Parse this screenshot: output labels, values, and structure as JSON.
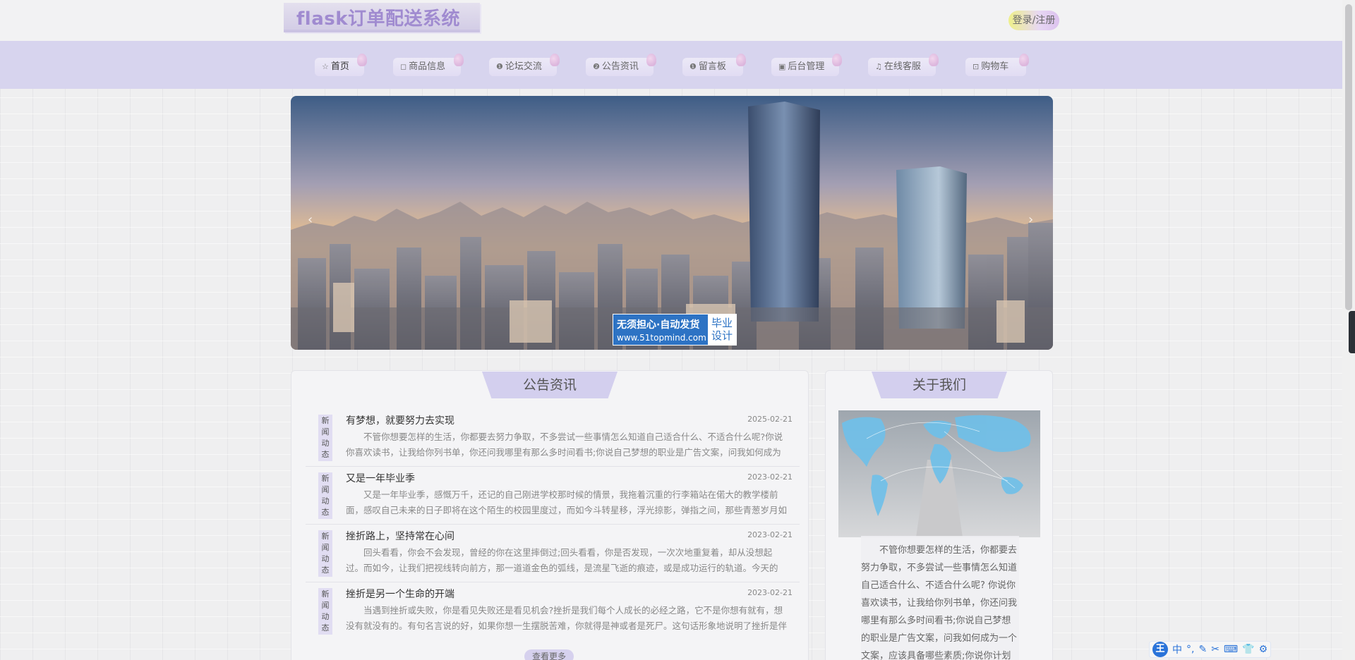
{
  "header": {
    "logo_text": "flask订单配送系统",
    "login_label": "登录/注册"
  },
  "nav": {
    "items": [
      {
        "icon": "☆",
        "icon_name": "star-icon",
        "label": "首页",
        "active": true
      },
      {
        "icon": "◻",
        "icon_name": "bag-icon",
        "label": "商品信息"
      },
      {
        "icon": "❶",
        "icon_name": "info-icon",
        "label": "论坛交流"
      },
      {
        "icon": "❷",
        "icon_name": "question-icon",
        "label": "公告资讯"
      },
      {
        "icon": "❶",
        "icon_name": "info-icon",
        "label": "留言板"
      },
      {
        "icon": "▣",
        "icon_name": "briefcase-icon",
        "label": "后台管理"
      },
      {
        "icon": "♫",
        "icon_name": "headset-icon",
        "label": "在线客服"
      },
      {
        "icon": "⊡",
        "icon_name": "cart-icon",
        "label": "购物车"
      }
    ]
  },
  "banner": {
    "promo_main": "无须担心·自动发货",
    "promo_url": "www.51topmind.com",
    "promo_side": "毕业 设计",
    "prev_icon": "‹",
    "next_icon": "›"
  },
  "news": {
    "title": "公告资讯",
    "tag": "新闻动态",
    "more_label": "查看更多",
    "items": [
      {
        "title": "有梦想，就要努力去实现",
        "date": "2025-02-21",
        "summary": "不管你想要怎样的生活，你都要去努力争取，不多尝试一些事情怎么知道自己适合什么、不适合什么呢?你说你喜欢读书，让我给你列书单，你还问我哪里有那么多时间看书;你说自己梦想的职业是广告文案，问我如何成为一个文案，应该具备哪些素质"
      },
      {
        "title": "又是一年毕业季",
        "date": "2023-02-21",
        "summary": "又是一年毕业季，感慨万千，还记的自己刚进学校那时候的情景，我拖着沉重的行李箱站在偌大的教学楼前面，感叹自己未来的日子即将在这个陌生的校园里度过，而如今斗转星移，浮光掠影，弹指之间，那些青葱岁月如同白驹过隙般悄然从指尖流逝"
      },
      {
        "title": "挫折路上，坚持常在心间",
        "date": "2023-02-21",
        "summary": "回头看看，你会不会发现，曾经的你在这里摔倒过;回头看看，你是否发现，一次次地重复着，却从没想起过。而如今，让我们把视线转向前方，那一道道金色的弧线，是流星飞逝的痕迹，或是成功运行的轨道。今天的你，是否依旧坚持"
      },
      {
        "title": "挫折是另一个生命的开端",
        "date": "2023-02-21",
        "summary": "当遇到挫折或失败，你是看见失败还是看见机会?挫折是我们每个人成长的必经之路，它不是你想有就有，想没有就没有的。有句名言说的好，如果你想一生摆脱苦难，你就得是神或者是死尸。这句话形象地说明了挫折是伴随人生的"
      }
    ]
  },
  "about": {
    "title": "关于我们",
    "text": "不管你想要怎样的生活，你都要去努力争取，不多尝试一些事情怎么知道自己适合什么、不适合什么呢? 你说你喜欢读书，让我给你列书单，你还问我哪里有那么多时间看书;你说自己梦想的职业是广告文案，问我如何成为一个文案，应该具备哪些素质;你说你计划"
  },
  "ime": {
    "logo": "王",
    "items": [
      "中",
      "°,",
      "✎",
      "✂",
      "⌨",
      "👕",
      "⚙"
    ]
  }
}
